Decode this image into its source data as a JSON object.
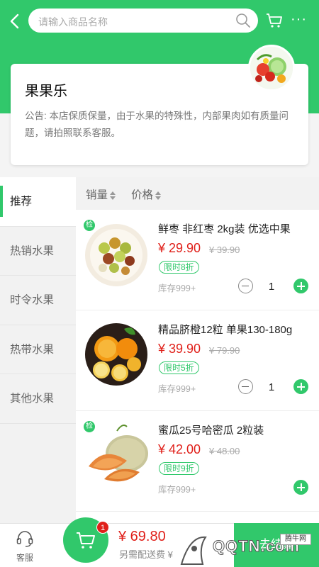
{
  "header": {
    "search_placeholder": "请输入商品名称",
    "more_label": "···"
  },
  "shop": {
    "name": "果果乐",
    "notice": "公告: 本店保质保量，由于水果的特殊性，内部果肉如有质量问题，请拍照联系客服。"
  },
  "categories": [
    {
      "label": "推荐",
      "active": true
    },
    {
      "label": "热销水果",
      "active": false
    },
    {
      "label": "时令水果",
      "active": false
    },
    {
      "label": "热带水果",
      "active": false
    },
    {
      "label": "其他水果",
      "active": false
    }
  ],
  "sort": {
    "sales_label": "销量",
    "price_label": "价格"
  },
  "products": [
    {
      "badge": "检",
      "title": "鲜枣 非红枣 2kg装 优选中果",
      "price": "¥ 29.90",
      "old_price": "¥ 39.90",
      "discount": "限时8折",
      "stock": "库存999+",
      "qty": "1"
    },
    {
      "badge": "",
      "title": "精品脐橙12粒 单果130-180g",
      "price": "¥ 39.90",
      "old_price": "¥ 79.90",
      "discount": "限时5折",
      "stock": "库存999+",
      "qty": "1"
    },
    {
      "badge": "检",
      "title": "蜜瓜25号哈密瓜 2粒装",
      "price": "¥ 42.00",
      "old_price": "¥ 48.00",
      "discount": "限时9折",
      "stock": "库存999+",
      "qty": ""
    }
  ],
  "bottom": {
    "service_label": "客服",
    "cart_count": "1",
    "total": "¥ 69.80",
    "delivery_note": "另需配送费 ¥",
    "checkout_label": "去结算"
  },
  "watermark": {
    "text": "QQTN.com",
    "tag": "腾牛网"
  },
  "colors": {
    "brand_green": "#31c86b",
    "price_red": "#e0201a"
  }
}
